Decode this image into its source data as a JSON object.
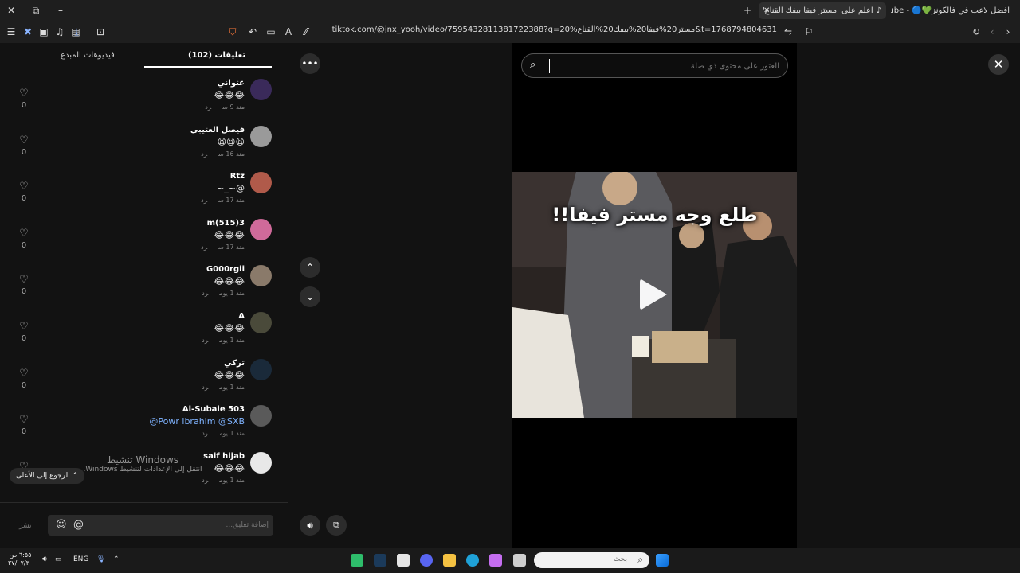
{
  "browser": {
    "tabs": [
      {
        "label": "افضل لاعب في فالكونز💚🔵 - YouTube",
        "active": false
      },
      {
        "label": "اعلم على 'مستر فيفا بيفك القناع' ...",
        "active": true
      }
    ],
    "url": "tiktok.com/@jnx_yooh/video/7595432811381722388?q=20%مستر20%فيفا20%بيفك20%القناع&t=1768794804631"
  },
  "comments_panel": {
    "tab_comments": "تعليقات (102)",
    "tab_creator_videos": "فيديوهات المبدع",
    "reply_label": "رد",
    "comments": [
      {
        "name": "عتواني",
        "text": "😂😂😂",
        "time": "منذ 9 س",
        "likes": "0",
        "avatar_color": "#3a2a5a"
      },
      {
        "name": "فيصل العتيبي",
        "text": "😫😫😫",
        "time": "منذ 16 س",
        "likes": "0",
        "avatar_color": "#9a9a9a"
      },
      {
        "name": "Rtz",
        "text": "~_~@",
        "time": "منذ 17 س",
        "likes": "0",
        "avatar_color": "#b05a4a"
      },
      {
        "name": "m(515)3",
        "text": "😂😂😂",
        "time": "منذ 17 س",
        "likes": "0",
        "avatar_color": "#d06a9a"
      },
      {
        "name": "G000rgii",
        "text": "😂😂😂",
        "time": "منذ 1 يوم",
        "likes": "0",
        "avatar_color": "#8a7a6a"
      },
      {
        "name": "A",
        "text": "😂😂😂",
        "time": "منذ 1 يوم",
        "likes": "0",
        "avatar_color": "#4a4a3a"
      },
      {
        "name": "تركي",
        "text": "😂😂😂",
        "time": "منذ 1 يوم",
        "likes": "0",
        "avatar_color": "#1a2a3a"
      },
      {
        "name": "Al-Subaie 503",
        "text": "@Powr ibrahim @SXB",
        "time": "منذ 1 يوم",
        "likes": "0",
        "avatar_color": "#5a5a5a",
        "mention": true
      },
      {
        "name": "saif hijab",
        "text": "😂😂😂",
        "time": "منذ 1 يوم",
        "likes": "0",
        "avatar_color": "#e8e8e8"
      }
    ],
    "back_to_top": "الرجوع إلى الأعلى ⌃",
    "input_placeholder": "إضافة تعليق...",
    "post_label": "نشر"
  },
  "watermark": {
    "title": "تنشيط Windows",
    "subtitle": "انتقل إلى الإعدادات لتنشيط Windows."
  },
  "video": {
    "search_placeholder": "العثور على محتوى ذي صلة",
    "caption": "طلع وجه مستر فيفا!!"
  },
  "taskbar": {
    "search_placeholder": "بحث",
    "language": "ENG",
    "time": "٦:٥٥ ص",
    "date": "٢٧/٠٧/٣٠"
  }
}
